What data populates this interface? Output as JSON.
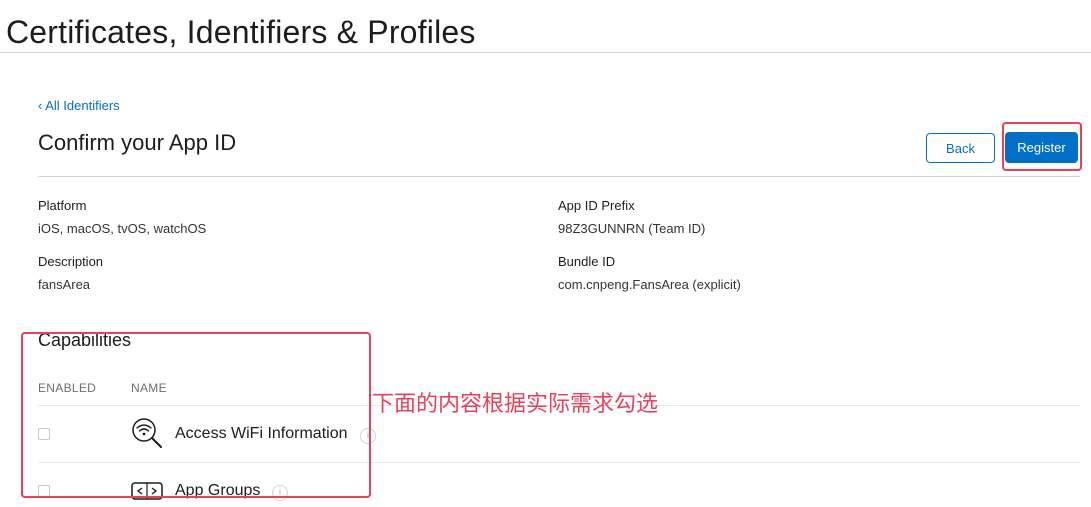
{
  "header": {
    "title": "Certificates, Identifiers & Profiles"
  },
  "breadcrumb": {
    "back_link": "‹ All Identifiers"
  },
  "section": {
    "title": "Confirm your App ID"
  },
  "actions": {
    "back_label": "Back",
    "register_label": "Register"
  },
  "details": {
    "platform_label": "Platform",
    "platform_value": "iOS, macOS, tvOS, watchOS",
    "prefix_label": "App ID Prefix",
    "prefix_value": "98Z3GUNNRN (Team ID)",
    "description_label": "Description",
    "description_value": "fansArea",
    "bundle_label": "Bundle ID",
    "bundle_value": "com.cnpeng.FansArea (explicit)"
  },
  "capabilities": {
    "title": "Capabilities",
    "col_enabled": "ENABLED",
    "col_name": "NAME",
    "items": [
      {
        "name": "Access WiFi Information",
        "icon": "wifi-search-icon",
        "enabled": false
      },
      {
        "name": "App Groups",
        "icon": "app-groups-icon",
        "enabled": false
      }
    ]
  },
  "annotation": {
    "text": "下面的内容根据实际需求勾选"
  },
  "colors": {
    "accent": "#0070c9",
    "highlight": "#e8425a"
  }
}
